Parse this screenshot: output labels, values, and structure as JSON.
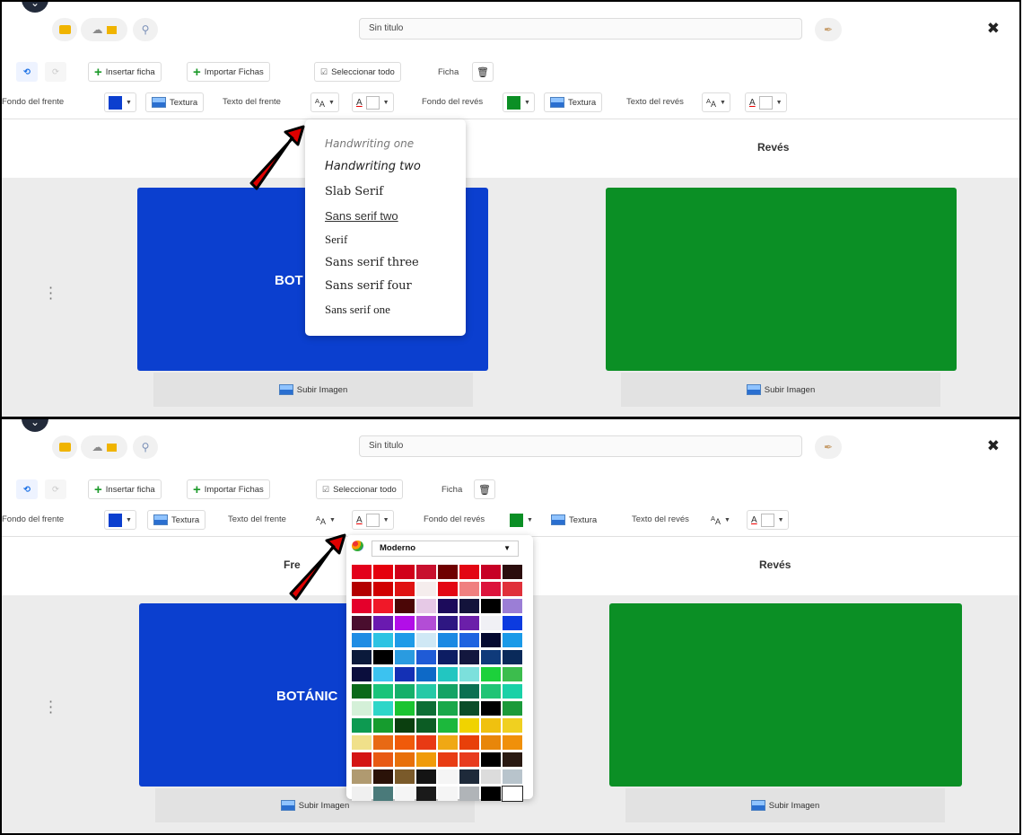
{
  "header": {
    "title_value": "Sin titulo",
    "collapse_icon": "chevron-down-icon"
  },
  "toolbar": {
    "insert_label": "Insertar ficha",
    "import_label": "Importar Fichas",
    "select_all_label": "Seleccionar todo",
    "ficha_label": "Ficha"
  },
  "style_bar": {
    "front_bg_label": "Fondo del frente",
    "front_bg_color": "#0b3fcf",
    "texture_label": "Textura",
    "front_text_label": "Texto del frente",
    "back_bg_label": "Fondo del revés",
    "back_bg_color": "#0b8f25",
    "back_text_label": "Texto del revés"
  },
  "card": {
    "front_heading": "Frente",
    "back_heading": "Revés",
    "front_color": "#0b3fcf",
    "back_color": "#0b8f25",
    "upload_label": "Subir Imagen"
  },
  "panel1": {
    "front_heading_visible": "",
    "front_text": "BOT",
    "font_options": [
      "Handwriting one",
      "Handwriting two",
      "Slab Serif",
      "Sans serif two",
      "Serif",
      "Sans serif three",
      "Sans serif four",
      "Sans serif one"
    ]
  },
  "panel2": {
    "front_heading_visible": "Fre",
    "front_text": "BOTÁNIC",
    "palette_name": "Moderno",
    "palette": [
      "#e3001b",
      "#e5000d",
      "#d10019",
      "#c8102e",
      "#6f0000",
      "#e30613",
      "#c70025",
      "#2b0d0d",
      "#b30000",
      "#d10000",
      "#e01212",
      "#f5eded",
      "#e30613",
      "#f08080",
      "#dc143c",
      "#e0303a",
      "#e4002b",
      "#f01828",
      "#4b0606",
      "#e6c9e6",
      "#1c0b5b",
      "#13133b",
      "#000000",
      "#9b7ed6",
      "#4a0e2e",
      "#6a1ab0",
      "#b20ee8",
      "#b34dd6",
      "#2e1782",
      "#6b1fa9",
      "#f0f0f5",
      "#0c3be0",
      "#1f8de4",
      "#2cc3e3",
      "#1e9be8",
      "#cfe8f5",
      "#1b89e3",
      "#1e63e0",
      "#050a30",
      "#1a9ae8",
      "#0b1a3b",
      "#000000",
      "#2a9be0",
      "#1f5bd6",
      "#0d1d63",
      "#13173e",
      "#0f3a7a",
      "#0a2a5a",
      "#0b0e3d",
      "#3cc2f0",
      "#1430b5",
      "#0d69c7",
      "#22c6c1",
      "#7ce0dc",
      "#1cd13b",
      "#3cbd4d",
      "#0b6a1a",
      "#1ac47a",
      "#15b06a",
      "#26c9a6",
      "#14a365",
      "#0b7052",
      "#21c475",
      "#1ad1a7",
      "#d4f0d8",
      "#2ed6c8",
      "#1ac431",
      "#0d6e35",
      "#19a84a",
      "#0b4d29",
      "#000000",
      "#1b9a3a",
      "#0d9a51",
      "#169c2e",
      "#0b3f0f",
      "#0c5c24",
      "#1cb83c",
      "#f0d300",
      "#f0c10f",
      "#f0d020",
      "#f0e08a",
      "#e86914",
      "#f05a0a",
      "#e83a14",
      "#f0a814",
      "#e8400a",
      "#e8860a",
      "#f0900a",
      "#d41414",
      "#e85a14",
      "#e8700a",
      "#f09b0a",
      "#e83c14",
      "#e83c1e",
      "#000000",
      "#2a1a12",
      "#b09a70",
      "#2a1208",
      "#7a5a2a",
      "#141414",
      "#f5f5f5",
      "#1e2a3a",
      "#dcdcdc",
      "#b8c4cc",
      "#f0f0f0",
      "#4a7a7a",
      "#f5f5f5",
      "#1a1a1a",
      "#f5f5f5",
      "#b0b4b8",
      "#000000",
      "#ffffff"
    ]
  }
}
